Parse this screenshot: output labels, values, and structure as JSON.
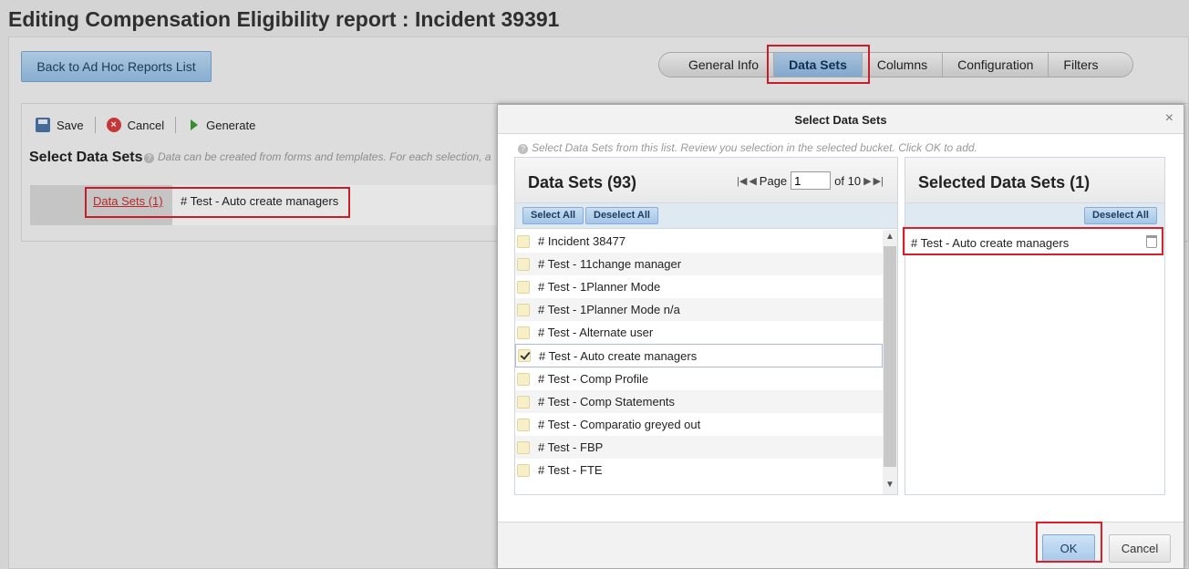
{
  "page": {
    "title": "Editing Compensation Eligibility report : Incident 39391",
    "back_button": "Back to Ad Hoc Reports List"
  },
  "tabs": [
    {
      "label": "General Info"
    },
    {
      "label": "Data Sets",
      "active": true
    },
    {
      "label": "Columns"
    },
    {
      "label": "Configuration"
    },
    {
      "label": "Filters"
    }
  ],
  "toolbar": {
    "save": "Save",
    "cancel": "Cancel",
    "generate": "Generate"
  },
  "select_section": {
    "heading": "Select Data Sets",
    "hint": "Data can be created from forms and templates. For each selection, a",
    "link_label": "Data Sets (1)",
    "value": "# Test - Auto create managers"
  },
  "modal": {
    "title": "Select Data Sets",
    "close": "×",
    "hint": "Select Data Sets from this list. Review you selection in the selected bucket. Click OK to add.",
    "left": {
      "title": "Data Sets (93)",
      "select_all": "Select All",
      "deselect_all": "Deselect All",
      "page_label": "Page",
      "page_value": "1",
      "page_of": "of 10",
      "items": [
        {
          "label": "# Incident 38477",
          "checked": false
        },
        {
          "label": "# Test - 11change manager",
          "checked": false
        },
        {
          "label": "# Test - 1Planner Mode",
          "checked": false
        },
        {
          "label": "# Test - 1Planner Mode n/a",
          "checked": false
        },
        {
          "label": "# Test - Alternate user",
          "checked": false
        },
        {
          "label": "# Test - Auto create managers",
          "checked": true
        },
        {
          "label": "# Test - Comp Profile",
          "checked": false
        },
        {
          "label": "# Test - Comp Statements",
          "checked": false
        },
        {
          "label": "# Test - Comparatio greyed out",
          "checked": false
        },
        {
          "label": "# Test - FBP",
          "checked": false
        },
        {
          "label": "# Test - FTE",
          "checked": false
        }
      ]
    },
    "right": {
      "title": "Selected Data Sets (1)",
      "deselect_all": "Deselect All",
      "items": [
        {
          "label": "# Test - Auto create managers"
        }
      ]
    },
    "ok": "OK",
    "cancel": "Cancel"
  },
  "colors": {
    "highlight": "#d9202a",
    "accent": "#a6c8ea",
    "checkbox": "#f7efc7"
  }
}
